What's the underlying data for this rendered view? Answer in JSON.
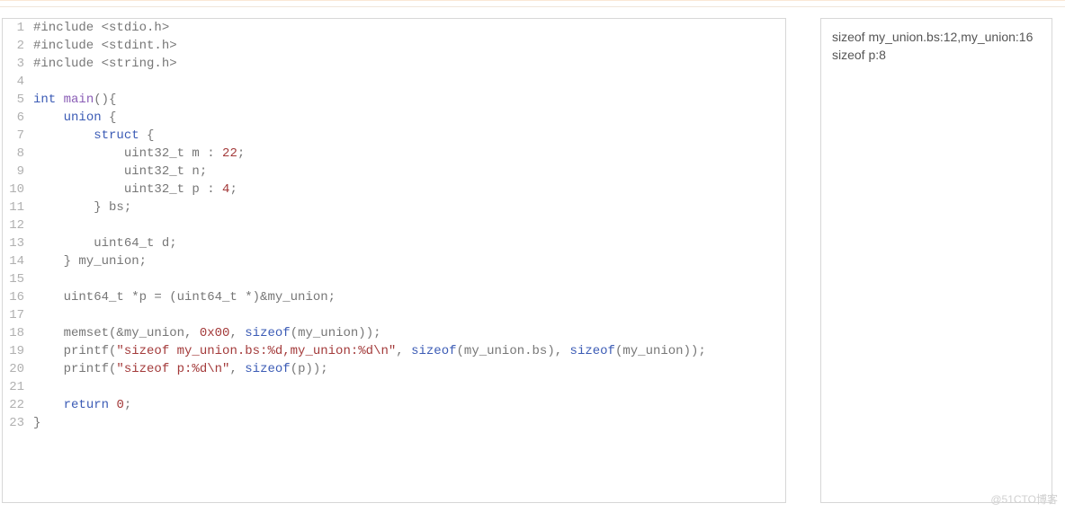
{
  "code": {
    "lines": [
      {
        "n": 1,
        "tokens": [
          {
            "t": "preproc",
            "v": "#include <stdio.h>"
          }
        ]
      },
      {
        "n": 2,
        "tokens": [
          {
            "t": "preproc",
            "v": "#include <stdint.h>"
          }
        ]
      },
      {
        "n": 3,
        "tokens": [
          {
            "t": "preproc",
            "v": "#include <string.h>"
          }
        ]
      },
      {
        "n": 4,
        "tokens": []
      },
      {
        "n": 5,
        "tokens": [
          {
            "t": "type",
            "v": "int"
          },
          {
            "t": "op",
            "v": " "
          },
          {
            "t": "fn",
            "v": "main"
          },
          {
            "t": "op",
            "v": "(){"
          }
        ]
      },
      {
        "n": 6,
        "tokens": [
          {
            "t": "op",
            "v": "    "
          },
          {
            "t": "struct-k",
            "v": "union"
          },
          {
            "t": "op",
            "v": " {"
          }
        ]
      },
      {
        "n": 7,
        "tokens": [
          {
            "t": "op",
            "v": "        "
          },
          {
            "t": "struct-k",
            "v": "struct"
          },
          {
            "t": "op",
            "v": " {"
          }
        ]
      },
      {
        "n": 8,
        "tokens": [
          {
            "t": "op",
            "v": "            uint32_t m : "
          },
          {
            "t": "lit",
            "v": "22"
          },
          {
            "t": "op",
            "v": ";"
          }
        ]
      },
      {
        "n": 9,
        "tokens": [
          {
            "t": "op",
            "v": "            uint32_t n;"
          }
        ]
      },
      {
        "n": 10,
        "tokens": [
          {
            "t": "op",
            "v": "            uint32_t p : "
          },
          {
            "t": "lit",
            "v": "4"
          },
          {
            "t": "op",
            "v": ";"
          }
        ]
      },
      {
        "n": 11,
        "tokens": [
          {
            "t": "op",
            "v": "        } bs;"
          }
        ]
      },
      {
        "n": 12,
        "tokens": []
      },
      {
        "n": 13,
        "tokens": [
          {
            "t": "op",
            "v": "        uint64_t d;"
          }
        ]
      },
      {
        "n": 14,
        "tokens": [
          {
            "t": "op",
            "v": "    } my_union;"
          }
        ]
      },
      {
        "n": 15,
        "tokens": []
      },
      {
        "n": 16,
        "tokens": [
          {
            "t": "op",
            "v": "    uint64_t *p = (uint64_t *)&my_union;"
          }
        ]
      },
      {
        "n": 17,
        "tokens": []
      },
      {
        "n": 18,
        "tokens": [
          {
            "t": "op",
            "v": "    memset(&my_union, "
          },
          {
            "t": "lit",
            "v": "0x00"
          },
          {
            "t": "op",
            "v": ", "
          },
          {
            "t": "keyword",
            "v": "sizeof"
          },
          {
            "t": "op",
            "v": "(my_union));"
          }
        ]
      },
      {
        "n": 19,
        "tokens": [
          {
            "t": "op",
            "v": "    printf("
          },
          {
            "t": "lit",
            "v": "\"sizeof my_union.bs:%d,my_union:%d\\n\""
          },
          {
            "t": "op",
            "v": ", "
          },
          {
            "t": "keyword",
            "v": "sizeof"
          },
          {
            "t": "op",
            "v": "(my_union.bs), "
          },
          {
            "t": "keyword",
            "v": "sizeof"
          },
          {
            "t": "op",
            "v": "(my_union));"
          }
        ]
      },
      {
        "n": 20,
        "tokens": [
          {
            "t": "op",
            "v": "    printf("
          },
          {
            "t": "lit",
            "v": "\"sizeof p:%d\\n\""
          },
          {
            "t": "op",
            "v": ", "
          },
          {
            "t": "keyword",
            "v": "sizeof"
          },
          {
            "t": "op",
            "v": "(p));"
          }
        ]
      },
      {
        "n": 21,
        "tokens": []
      },
      {
        "n": 22,
        "tokens": [
          {
            "t": "op",
            "v": "    "
          },
          {
            "t": "keyword",
            "v": "return"
          },
          {
            "t": "op",
            "v": " "
          },
          {
            "t": "lit",
            "v": "0"
          },
          {
            "t": "op",
            "v": ";"
          }
        ]
      },
      {
        "n": 23,
        "tokens": [
          {
            "t": "op",
            "v": "}"
          }
        ]
      }
    ]
  },
  "output": {
    "lines": [
      "sizeof my_union.bs:12,my_union:16",
      "sizeof p:8"
    ]
  },
  "watermark": "@51CTO博客"
}
